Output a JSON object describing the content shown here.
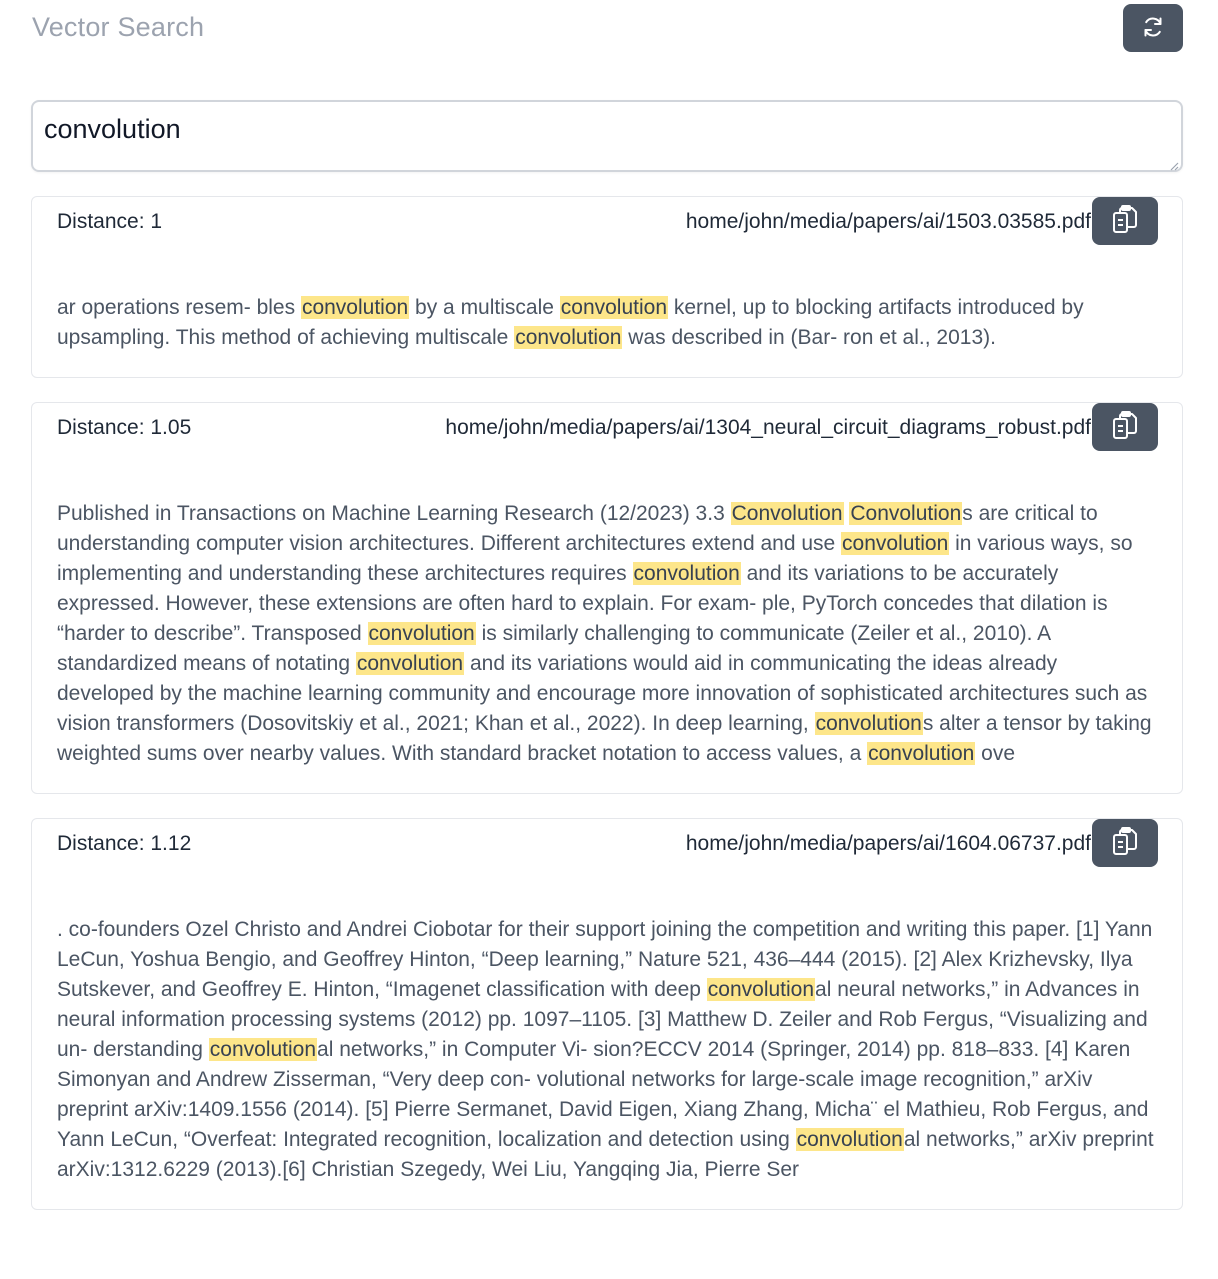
{
  "header": {
    "title": "Vector Search",
    "refresh_icon": "refresh-icon"
  },
  "search": {
    "value": "convolution"
  },
  "results": [
    {
      "distance": "Distance: 1",
      "path": "home/john/media/papers/ai/1503.03585.pdf",
      "copy_icon": "clipboard-copy-icon",
      "segments": [
        {
          "text": "ar operations resem- bles "
        },
        {
          "text": "convolution",
          "hl": true
        },
        {
          "text": " by a multiscale "
        },
        {
          "text": "convolution",
          "hl": true
        },
        {
          "text": " kernel, up to blocking artifacts introduced by upsampling. This method of achieving multiscale "
        },
        {
          "text": "convolution",
          "hl": true
        },
        {
          "text": " was described in (Bar- ron et al., 2013)."
        }
      ]
    },
    {
      "distance": "Distance: 1.05",
      "path": "home/john/media/papers/ai/1304_neural_circuit_diagrams_robust.pdf",
      "copy_icon": "clipboard-copy-icon",
      "segments": [
        {
          "text": "Published in Transactions on Machine Learning Research (12/2023) 3.3 "
        },
        {
          "text": "Convolution",
          "hl": true
        },
        {
          "text": " "
        },
        {
          "text": "Convolution",
          "hl": true
        },
        {
          "text": "s are critical to understanding computer vision architectures. Different architectures extend and use "
        },
        {
          "text": "convolution",
          "hl": true
        },
        {
          "text": " in various ways, so implementing and understanding these architectures requires "
        },
        {
          "text": "convolution",
          "hl": true
        },
        {
          "text": " and its variations to be accurately expressed. However, these extensions are often hard to explain. For exam- ple, PyTorch concedes that dilation is “harder to describe”. Transposed "
        },
        {
          "text": "convolution",
          "hl": true
        },
        {
          "text": " is similarly challenging to communicate (Zeiler et al., 2010). A standardized means of notating "
        },
        {
          "text": "convolution",
          "hl": true
        },
        {
          "text": " and its variations would aid in communicating the ideas already developed by the machine learning community and encourage more innovation of sophisticated architectures such as vision transformers (Dosovitskiy et al., 2021; Khan et al., 2022). In deep learning, "
        },
        {
          "text": "convolution",
          "hl": true
        },
        {
          "text": "s alter a tensor by taking weighted sums over nearby values. With standard bracket notation to access values, a "
        },
        {
          "text": "convolution",
          "hl": true
        },
        {
          "text": " ove"
        }
      ]
    },
    {
      "distance": "Distance: 1.12",
      "path": "home/john/media/papers/ai/1604.06737.pdf",
      "copy_icon": "clipboard-copy-icon",
      "segments": [
        {
          "text": ". co-founders Ozel Christo and Andrei Ciobotar for their support joining the competition and writing this paper. [1] Yann LeCun, Yoshua Bengio, and Geoffrey Hinton, “Deep learning,” Nature 521, 436–444 (2015). [2] Alex Krizhevsky, Ilya Sutskever, and Geoffrey E. Hinton, “Imagenet classification with deep "
        },
        {
          "text": "convolution",
          "hl": true
        },
        {
          "text": "al neural networks,” in Advances in neural information processing systems (2012) pp. 1097–1105. [3] Matthew D. Zeiler and Rob Fergus, “Visualizing and un- derstanding "
        },
        {
          "text": "convolution",
          "hl": true
        },
        {
          "text": "al networks,” in Computer Vi- sion?ECCV 2014 (Springer, 2014) pp. 818–833. [4] Karen Simonyan and Andrew Zisserman, “Very deep con- volutional networks for large-scale image recognition,” arXiv preprint arXiv:1409.1556 (2014). [5] Pierre Sermanet, David Eigen, Xiang Zhang, Micha¨ el Mathieu, Rob Fergus, and Yann LeCun, “Overfeat: Integrated recognition, localization and detection using "
        },
        {
          "text": "convolution",
          "hl": true
        },
        {
          "text": "al networks,” arXiv preprint arXiv:1312.6229 (2013).[6] Christian Szegedy, Wei Liu, Yangqing Jia, Pierre Ser"
        }
      ]
    }
  ]
}
